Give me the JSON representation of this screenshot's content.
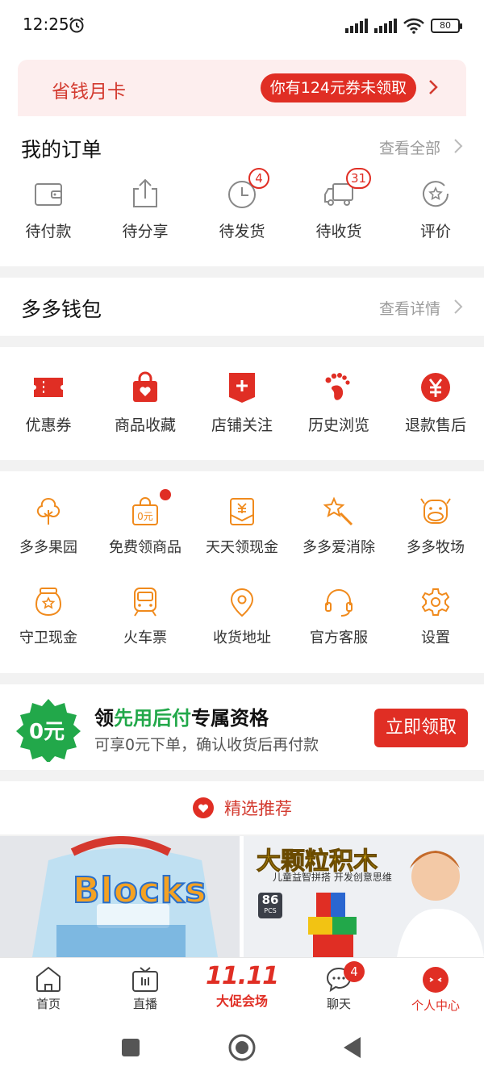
{
  "status_bar": {
    "time": "12:25",
    "battery": "80"
  },
  "monthly_card": {
    "title": "省钱月卡",
    "coupon_text": "你有124元券未领取"
  },
  "orders": {
    "title": "我的订单",
    "view_all": "查看全部",
    "items": [
      {
        "label": "待付款",
        "icon": "wallet-icon"
      },
      {
        "label": "待分享",
        "icon": "share-icon"
      },
      {
        "label": "待发货",
        "icon": "clock-icon",
        "badge": "4"
      },
      {
        "label": "待收货",
        "icon": "truck-icon",
        "badge": "31"
      },
      {
        "label": "评价",
        "icon": "review-icon"
      }
    ]
  },
  "wallet": {
    "title": "多多钱包",
    "view_details": "查看详情"
  },
  "quick_links": [
    {
      "label": "优惠券",
      "icon": "coupon-icon"
    },
    {
      "label": "商品收藏",
      "icon": "favorites-bag-icon"
    },
    {
      "label": "店铺关注",
      "icon": "store-follow-icon"
    },
    {
      "label": "历史浏览",
      "icon": "footprint-icon"
    },
    {
      "label": "退款售后",
      "icon": "refund-yen-icon"
    }
  ],
  "services": [
    {
      "label": "多多果园",
      "icon": "tree-icon"
    },
    {
      "label": "免费领商品",
      "icon": "free-bag-icon"
    },
    {
      "label": "天天领现金",
      "icon": "cash-envelope-icon"
    },
    {
      "label": "多多爱消除",
      "icon": "magic-wand-icon"
    },
    {
      "label": "多多牧场",
      "icon": "cow-icon"
    },
    {
      "label": "守卫现金",
      "icon": "cash-jar-icon"
    },
    {
      "label": "火车票",
      "icon": "train-icon"
    },
    {
      "label": "收货地址",
      "icon": "location-icon"
    },
    {
      "label": "官方客服",
      "icon": "headset-icon"
    },
    {
      "label": "设置",
      "icon": "gear-icon"
    }
  ],
  "pay_later": {
    "badge": "0元",
    "title_prefix": "领",
    "title_highlight": "先用后付",
    "title_suffix": "专属资格",
    "subtitle": "可享0元下单，确认收货后再付款",
    "button": "立即领取"
  },
  "recommend": {
    "title": "精选推荐"
  },
  "products": [
    {
      "brand_text": "Blocks"
    },
    {
      "headline": "大颗粒积木",
      "tagline": "儿童益智拼搭 开发创意思维",
      "pcs_count": "86",
      "pcs_unit": "PCS"
    }
  ],
  "tabbar": {
    "home": "首页",
    "live": "直播",
    "promo_big": "11.11",
    "promo": "大促会场",
    "chat": "聊天",
    "chat_badge": "4",
    "me": "个人中心"
  },
  "colors": {
    "accent": "#e02e24",
    "green": "#22a84a",
    "orange_icon": "#f08a1c"
  }
}
